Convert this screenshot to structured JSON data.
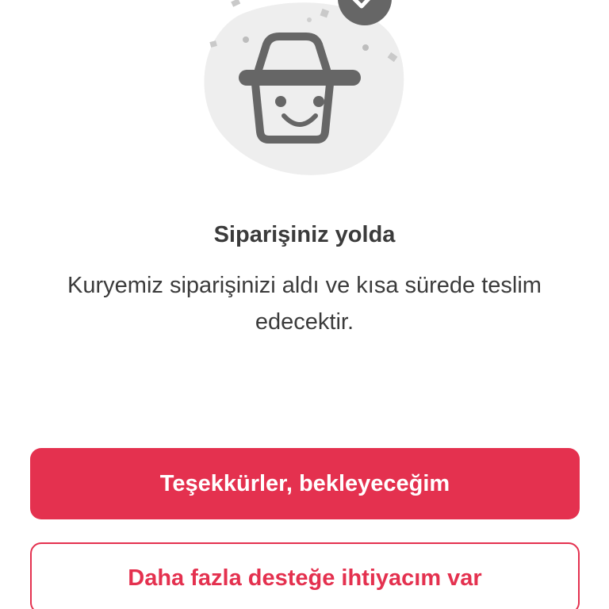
{
  "status": {
    "title": "Siparişiniz yolda",
    "message": "Kuryemiz siparişinizi aldı ve kısa sürede teslim edecektir."
  },
  "actions": {
    "primary_label": "Teşekkürler, bekleyeceğim",
    "secondary_label": "Daha fazla desteğe ihtiyacım var"
  },
  "icons": {
    "illustration": "smiling-basket-icon",
    "badge": "check-badge-icon"
  },
  "colors": {
    "accent": "#e4314f",
    "text": "#3b3b3b",
    "illustration_bg": "#eeeeee",
    "icon": "#666666"
  }
}
